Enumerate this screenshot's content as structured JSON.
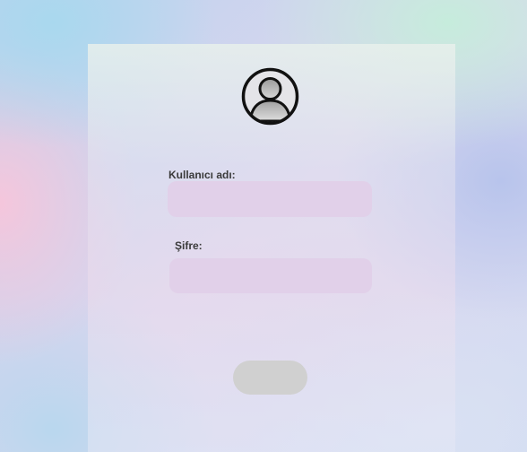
{
  "login": {
    "username_label": "Kullanıcı adı:",
    "username_value": "",
    "password_label": "Şifre:",
    "password_value": "",
    "submit_label": ""
  },
  "icons": {
    "avatar": "user-circle-icon"
  },
  "colors": {
    "field_background": "#e1d0e9",
    "button_background": "#d0d0d0",
    "label_text": "#3a3a3a"
  }
}
